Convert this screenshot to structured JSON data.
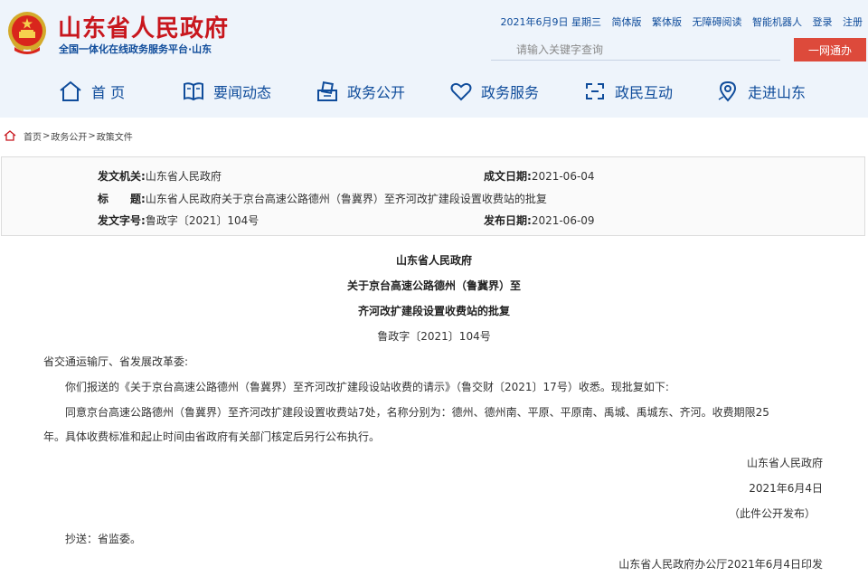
{
  "header": {
    "title": "山东省人民政府",
    "subtitle": "全国一体化在线政务服务平台·山东",
    "date": "2021年6月9日 星期三",
    "links": [
      "简体版",
      "繁体版",
      "无障碍阅读",
      "智能机器人",
      "登录",
      "注册"
    ],
    "search_placeholder": "请输入关键字查询",
    "search_button": "一网通办",
    "colors": {
      "brand_red": "#c8161d",
      "brand_blue": "#0f4c9b",
      "header_bg": "#eef4fb"
    }
  },
  "nav": [
    {
      "label": "首 页",
      "icon": "home-icon"
    },
    {
      "label": "要闻动态",
      "icon": "book-icon"
    },
    {
      "label": "政务公开",
      "icon": "ballot-icon"
    },
    {
      "label": "政务服务",
      "icon": "heart-icon"
    },
    {
      "label": "政民互动",
      "icon": "interaction-icon"
    },
    {
      "label": "走进山东",
      "icon": "location-icon"
    }
  ],
  "breadcrumb": {
    "items": [
      "首页",
      "政务公开",
      "政策文件"
    ],
    "separator": ">"
  },
  "meta": {
    "issuer_label": "发文机关:",
    "issuer": "山东省人民政府",
    "created_label": "成文日期:",
    "created": "2021-06-04",
    "title_label": "标　　题:",
    "title": "山东省人民政府关于京台高速公路德州（鲁冀界）至齐河改扩建段设置收费站的批复",
    "number_label": "发文字号:",
    "number": "鲁政字〔2021〕104号",
    "published_label": "发布日期:",
    "published": "2021-06-09"
  },
  "document": {
    "title_lines": [
      "山东省人民政府",
      "关于京台高速公路德州（鲁冀界）至",
      "齐河改扩建段设置收费站的批复"
    ],
    "number": "鲁政字〔2021〕104号",
    "salutation": "省交通运输厅、省发展改革委:",
    "para1": "你们报送的《关于京台高速公路德州（鲁冀界）至齐河改扩建段设站收费的请示》（鲁交财〔2021〕17号）收悉。现批复如下:",
    "para2_line1": "同意京台高速公路德州（鲁冀界）至齐河改扩建段设置收费站7处，名称分别为：德州、德州南、平原、平原南、禹城、禹城东、齐河。收费期限25",
    "para2_line2": "年。具体收费标准和起止时间由省政府有关部门核定后另行公布执行。",
    "signature": "山东省人民政府",
    "sign_date": "2021年6月4日",
    "disclosure": "（此件公开发布）",
    "cc": "抄送：省监委。",
    "print_info": "山东省人民政府办公厅2021年6月4日印发"
  }
}
